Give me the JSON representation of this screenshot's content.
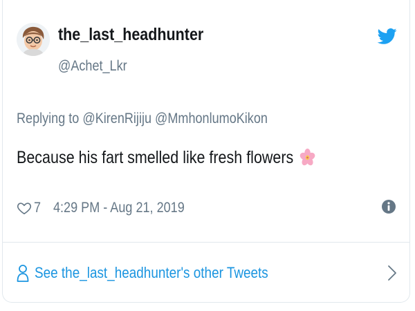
{
  "tweet": {
    "display_name": "the_last_headhunter",
    "handle": "@Achet_Lkr",
    "replying_prefix": "Replying to",
    "replying_to": [
      "@KirenRijiju",
      "@MmhonlumoKikon"
    ],
    "text": "Because his fart smelled like fresh flowers",
    "likes": "7",
    "timestamp": "4:29 PM - Aug 21, 2019"
  },
  "footer": {
    "other_tweets_label": "See the_last_headhunter's other Tweets"
  },
  "icons": {
    "brand": "twitter-bird-icon",
    "emoji": "cherry-blossom-icon",
    "like": "heart-icon",
    "info": "info-icon",
    "person": "person-icon",
    "chevron": "chevron-right-icon"
  },
  "colors": {
    "brand_blue": "#1da1f2",
    "link_blue": "#1b95e0",
    "secondary_text": "#657786",
    "primary_text": "#14171a",
    "border": "#e1e8ed"
  }
}
